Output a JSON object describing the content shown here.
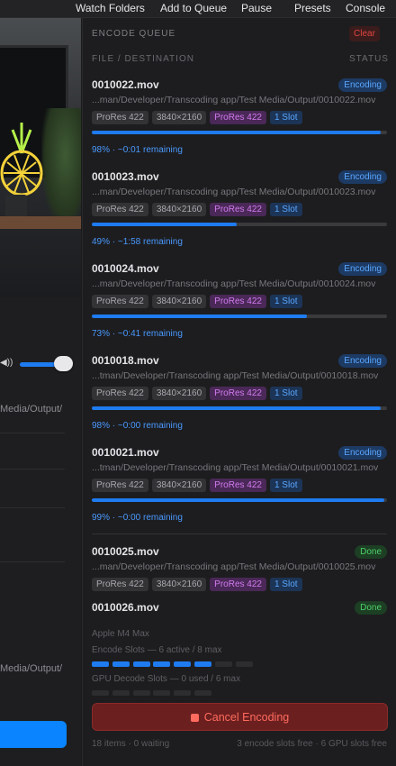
{
  "menu": {
    "items": [
      "Watch Folders",
      "Add to Queue",
      "Pause",
      "Presets",
      "Console"
    ]
  },
  "left_pane": {
    "volume": 0.8,
    "path_fragment_1": "Media/Output/",
    "path_fragment_2": "Media/Output/"
  },
  "queue": {
    "title": "ENCODE QUEUE",
    "clear_label": "Clear",
    "col_file": "FILE / DESTINATION",
    "col_status": "STATUS",
    "jobs": [
      {
        "name": "0010022.mov",
        "status": "Encoding",
        "path": "...man/Developer/Transcoding app/Test Media/Output/0010022.mov",
        "codec": "ProRes 422",
        "resolution": "3840×2160",
        "target": "ProRes 422",
        "slots": "1 Slot",
        "progress": 98,
        "stat": "98%  · ~0:01 remaining"
      },
      {
        "name": "0010023.mov",
        "status": "Encoding",
        "path": "...man/Developer/Transcoding app/Test Media/Output/0010023.mov",
        "codec": "ProRes 422",
        "resolution": "3840×2160",
        "target": "ProRes 422",
        "slots": "1 Slot",
        "progress": 49,
        "stat": "49%  · ~1:58 remaining"
      },
      {
        "name": "0010024.mov",
        "status": "Encoding",
        "path": "...man/Developer/Transcoding app/Test Media/Output/0010024.mov",
        "codec": "ProRes 422",
        "resolution": "3840×2160",
        "target": "ProRes 422",
        "slots": "1 Slot",
        "progress": 73,
        "stat": "73%  · ~0:41 remaining"
      },
      {
        "name": "0010018.mov",
        "status": "Encoding",
        "path": "...tman/Developer/Transcoding app/Test Media/Output/0010018.mov",
        "codec": "ProRes 422",
        "resolution": "3840×2160",
        "target": "ProRes 422",
        "slots": "1 Slot",
        "progress": 98,
        "stat": "98%  · ~0:00 remaining"
      },
      {
        "name": "0010021.mov",
        "status": "Encoding",
        "path": "...tman/Developer/Transcoding app/Test Media/Output/0010021.mov",
        "codec": "ProRes 422",
        "resolution": "3840×2160",
        "target": "ProRes 422",
        "slots": "1 Slot",
        "progress": 99,
        "stat": "99%  · ~0:00 remaining"
      }
    ],
    "done_job": {
      "name": "0010025.mov",
      "status": "Done",
      "path": "...man/Developer/Transcoding app/Test Media/Output/0010025.mov",
      "codec": "ProRes 422",
      "resolution": "3840×2160",
      "target": "ProRes 422",
      "slots": "1 Slot"
    },
    "done_job_2": {
      "name": "0010026.mov",
      "status": "Done"
    }
  },
  "hardware": {
    "chip": "Apple M4 Max",
    "encode_label": "Encode Slots — 6 active / 8 max",
    "encode_active": 6,
    "encode_max": 8,
    "decode_label": "GPU Decode Slots — 0 used / 6 max",
    "decode_used": 0,
    "decode_max": 6
  },
  "cancel_label": "Cancel Encoding",
  "footer": {
    "left": "18 items · 0 waiting",
    "right": "3 encode slots free · 6 GPU slots free"
  },
  "colors": {
    "accent": "#1e7bf0",
    "encoding_badge": "#5aa7ff",
    "done_badge": "#4cd168",
    "cancel": "#ff6b5e",
    "target_tag": "#d27bf0"
  }
}
